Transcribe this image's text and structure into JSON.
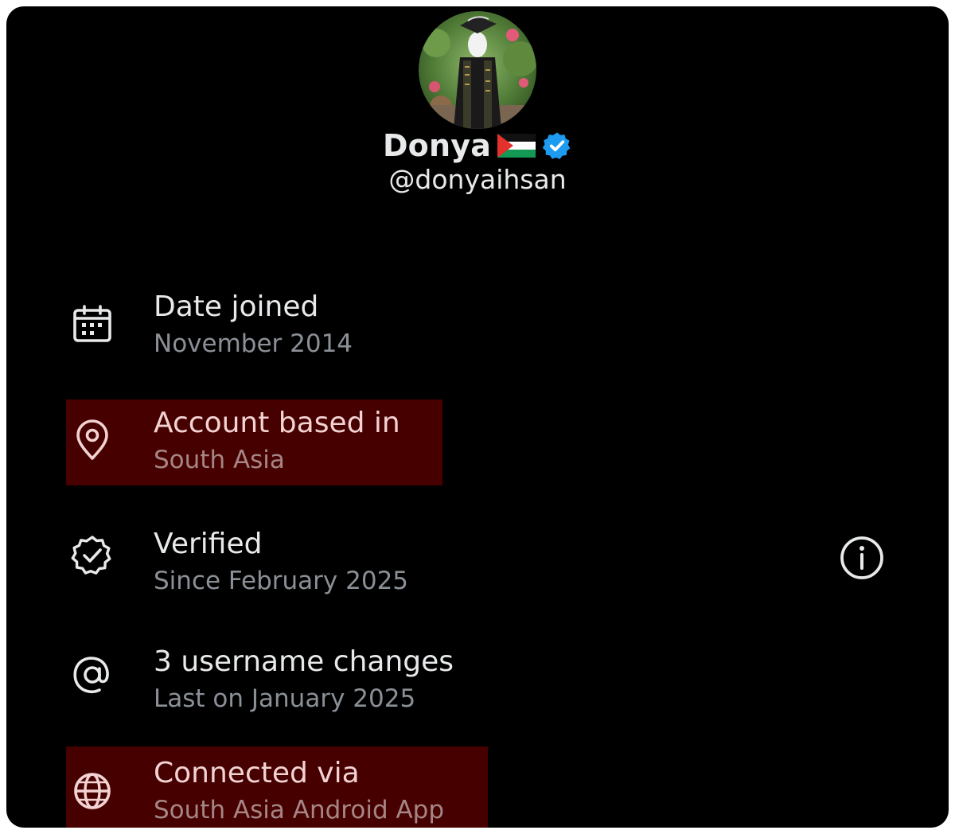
{
  "profile": {
    "display_name": "Donya",
    "handle": "@donyaihsan",
    "flag_icon": "palestine-flag",
    "verified_icon": "verified-badge-icon"
  },
  "rows": [
    {
      "icon": "calendar-icon",
      "title": "Date joined",
      "subtitle": "November 2014",
      "highlighted": false
    },
    {
      "icon": "location-pin-icon",
      "title": "Account based in",
      "subtitle": "South Asia",
      "highlighted": true
    },
    {
      "icon": "verified-check-icon",
      "title": "Verified",
      "subtitle": "Since February 2025",
      "highlighted": false
    },
    {
      "icon": "at-sign-icon",
      "title": "3 username changes",
      "subtitle": "Last on January 2025",
      "highlighted": false
    },
    {
      "icon": "globe-icon",
      "title": "Connected via",
      "subtitle": "South Asia Android App",
      "highlighted": true
    }
  ],
  "colors": {
    "background": "#000000",
    "text_primary": "#e7e9ea",
    "text_secondary": "#8b9097",
    "highlight": "#460000",
    "verified_blue": "#1d9bf0"
  }
}
